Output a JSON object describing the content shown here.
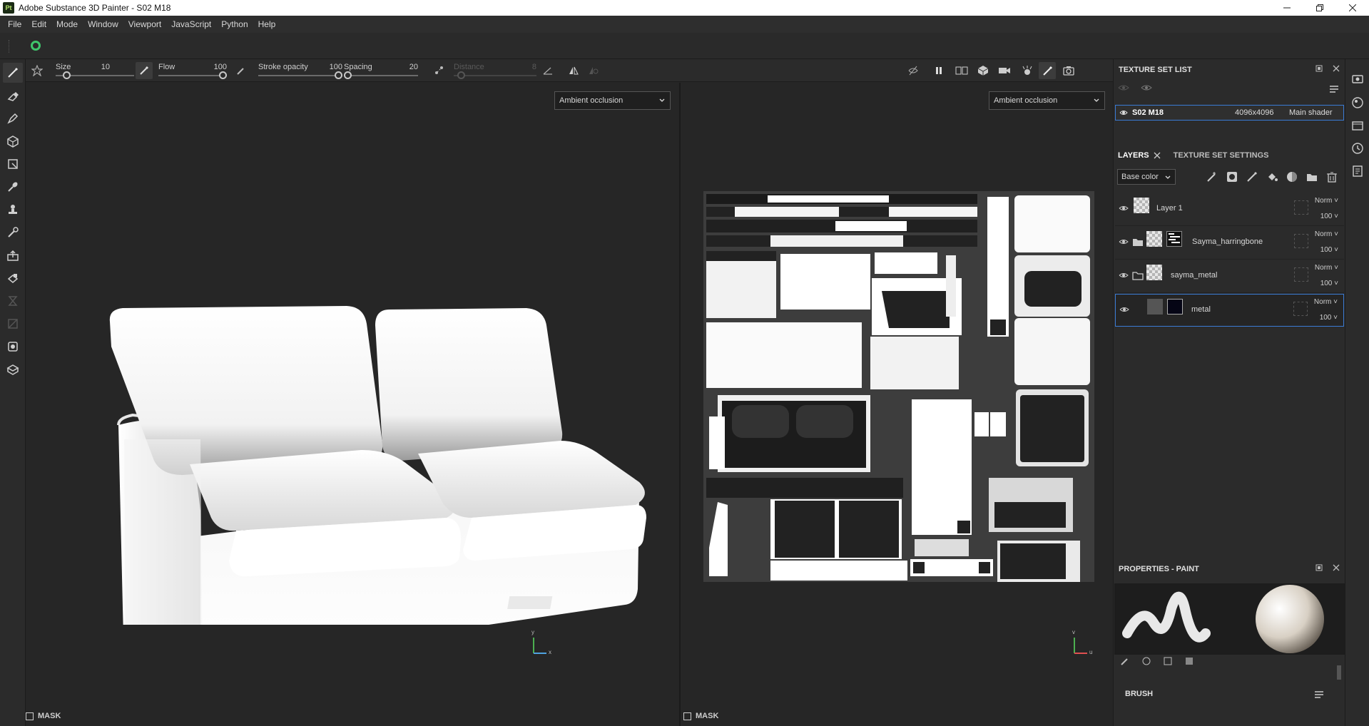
{
  "window": {
    "title": "Adobe Substance 3D Painter - S02 M18",
    "logo_text": "Pt",
    "controls": [
      "minimize",
      "maximize",
      "close"
    ]
  },
  "menu": [
    "File",
    "Edit",
    "Mode",
    "Window",
    "Viewport",
    "JavaScript",
    "Python",
    "Help"
  ],
  "tool_options": {
    "size": {
      "label": "Size",
      "value": "10",
      "fraction": 0.1
    },
    "flow": {
      "label": "Flow",
      "value": "100",
      "fraction": 1.0
    },
    "stroke_opacity": {
      "label": "Stroke opacity",
      "value": "100",
      "fraction": 1.0
    },
    "spacing": {
      "label": "Spacing",
      "value": "20",
      "fraction": 0.0
    },
    "distance": {
      "label": "Distance",
      "value": "8",
      "fraction": 0.05,
      "disabled": true
    }
  },
  "viewports": {
    "left": {
      "channel": "Ambient occlusion",
      "mask_label": "MASK",
      "axes": [
        "y",
        "x"
      ]
    },
    "right": {
      "channel": "Ambient occlusion",
      "mask_label": "MASK",
      "axes": [
        "v",
        "u"
      ]
    }
  },
  "texture_set_list": {
    "title": "TEXTURE SET LIST",
    "sets": [
      {
        "name": "S02 M18",
        "resolution": "4096x4096",
        "shader": "Main shader"
      }
    ]
  },
  "layers_panel": {
    "tabs": [
      "LAYERS",
      "TEXTURE SET SETTINGS"
    ],
    "channel": "Base color",
    "layers": [
      {
        "name": "Layer 1",
        "blend": "Norm",
        "opacity": "100",
        "type": "fill",
        "selected": false
      },
      {
        "name": "Sayma_harringbone",
        "blend": "Norm",
        "opacity": "100",
        "type": "folder",
        "selected": false
      },
      {
        "name": "sayma_metal",
        "blend": "Norm",
        "opacity": "100",
        "type": "folder-open",
        "selected": false
      },
      {
        "name": "metal",
        "blend": "Norm",
        "opacity": "100",
        "type": "paint",
        "selected": true
      }
    ]
  },
  "properties": {
    "title": "PROPERTIES - PAINT",
    "section": "BRUSH"
  },
  "colors": {
    "accent": "#3a7bd5",
    "shelf_green": "#3fc56b",
    "bg": "#262626",
    "panel": "#2b2b2b"
  }
}
